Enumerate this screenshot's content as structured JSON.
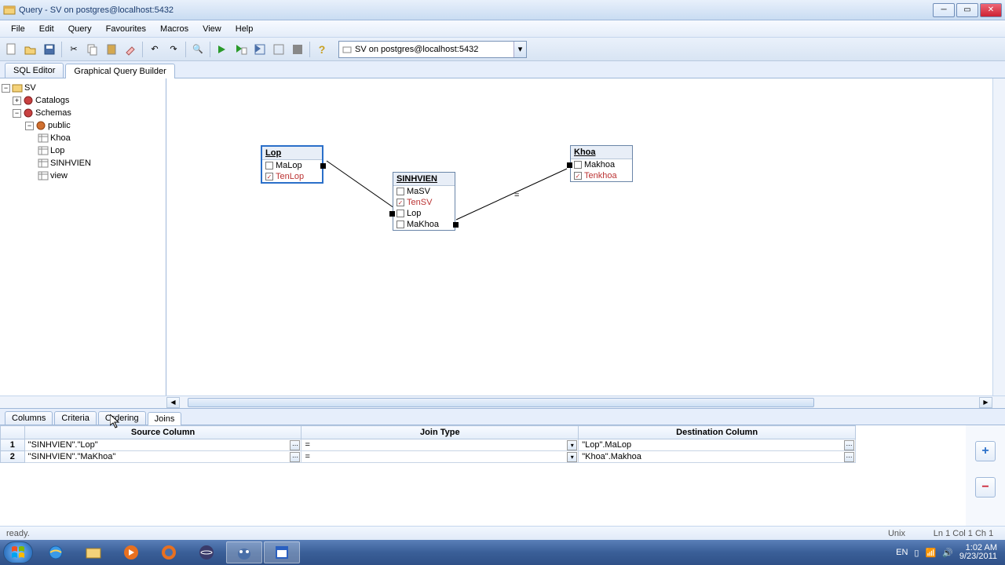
{
  "window": {
    "title": "Query - SV on postgres@localhost:5432"
  },
  "menu": [
    "File",
    "Edit",
    "Query",
    "Favourites",
    "Macros",
    "View",
    "Help"
  ],
  "connection": "SV on postgres@localhost:5432",
  "editor_tabs": {
    "items": [
      "SQL Editor",
      "Graphical Query Builder"
    ],
    "active": 1
  },
  "tree": {
    "root": "SV",
    "catalogs": "Catalogs",
    "schemas": "Schemas",
    "public": "public",
    "tables": [
      "Khoa",
      "Lop",
      "SINHVIEN",
      "view"
    ]
  },
  "diagram": {
    "lop": {
      "title": "Lop",
      "cols": [
        [
          "MaLop",
          false
        ],
        [
          "TenLop",
          true
        ]
      ]
    },
    "sinhvien": {
      "title": "SINHVIEN",
      "cols": [
        [
          "MaSV",
          false
        ],
        [
          "TenSV",
          true
        ],
        [
          "Lop",
          false
        ],
        [
          "MaKhoa",
          false
        ]
      ]
    },
    "khoa": {
      "title": "Khoa",
      "cols": [
        [
          "Makhoa",
          false
        ],
        [
          "Tenkhoa",
          true
        ]
      ]
    },
    "join_label": "="
  },
  "bottom_tabs": {
    "items": [
      "Columns",
      "Criteria",
      "Ordering",
      "Joins"
    ],
    "active": 3
  },
  "joins_grid": {
    "headers": [
      "Source Column",
      "Join Type",
      "Destination Column"
    ],
    "rows": [
      {
        "n": "1",
        "src": "\"SINHVIEN\".\"Lop\"",
        "jt": "=",
        "dst": "\"Lop\".MaLop"
      },
      {
        "n": "2",
        "src": "\"SINHVIEN\".\"MaKhoa\"",
        "jt": "=",
        "dst": "\"Khoa\".Makhoa"
      }
    ]
  },
  "status": {
    "msg": "ready.",
    "mode": "Unix",
    "pos": "Ln 1 Col 1 Ch 1"
  },
  "tray": {
    "lang": "EN",
    "time": "1:02 AM",
    "date": "9/23/2011"
  }
}
